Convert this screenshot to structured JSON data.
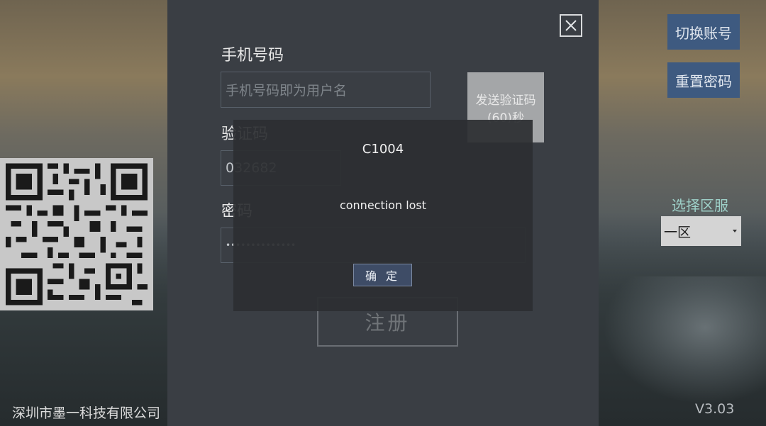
{
  "colors": {
    "panel": "#3a3e44",
    "side_button": "#3e5a80",
    "server_label": "#9ed0c8",
    "dialog_bg": "#2c2e32",
    "qr_bg": "#c8c8c8"
  },
  "form": {
    "phone_label": "手机号码",
    "phone_placeholder": "手机号码即为用户名",
    "code_label": "验证码",
    "code_value": "032682",
    "password_label": "密码",
    "password_value": "••••••••••••••",
    "send_code_line1": "发送验证码",
    "send_code_line2": "(60)秒",
    "register_label": "注册"
  },
  "side": {
    "switch_account": "切换账号",
    "reset_password": "重置密码",
    "server_label": "选择区服",
    "server_selected": "一区"
  },
  "footer": {
    "company": "深圳市墨一科技有限公司",
    "version": "V3.03"
  },
  "dialog": {
    "title": "C1004",
    "message": "connection lost",
    "ok_label": "确 定"
  },
  "icons": {
    "close": "close-icon",
    "qr": "qr-code-icon",
    "caret": "chevron-down-icon"
  }
}
